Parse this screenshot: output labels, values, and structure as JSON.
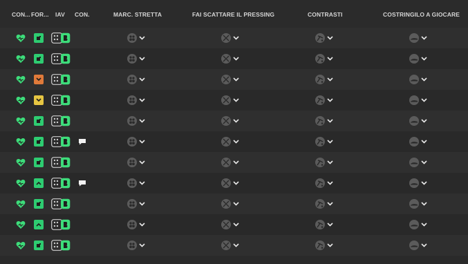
{
  "headers": {
    "condition": "CON...",
    "form": "FOR...",
    "iav": "IAV",
    "conversation": "CON.",
    "close_marking": "MARC. STRETTA",
    "trigger_press": "FAI SCATTARE IL PRESSING",
    "tackling": "CONTRASTI",
    "force_weak_foot": "COSTRINGILO A GIOCARE"
  },
  "colors": {
    "heart": "#3ddc7a",
    "form_good": "#2ecc71",
    "form_warn_orange": "#e07a3a",
    "form_warn_yellow": "#e6c542",
    "iav_green": "#3ddc7a",
    "dropdown_icon": "#5b5b5b"
  },
  "rows": [
    {
      "form": "good",
      "form_icon": "square-dot",
      "conversation": false
    },
    {
      "form": "good",
      "form_icon": "square-dot",
      "conversation": false
    },
    {
      "form": "orange",
      "form_icon": "chevron-down",
      "conversation": false
    },
    {
      "form": "yellow",
      "form_icon": "chevron-down",
      "conversation": false
    },
    {
      "form": "good",
      "form_icon": "square-dot",
      "conversation": false
    },
    {
      "form": "good",
      "form_icon": "square-dot",
      "conversation": true
    },
    {
      "form": "good",
      "form_icon": "square-dot",
      "conversation": false
    },
    {
      "form": "good",
      "form_icon": "chevron-up",
      "conversation": true
    },
    {
      "form": "good",
      "form_icon": "square-dot",
      "conversation": false
    },
    {
      "form": "good",
      "form_icon": "chevron-up",
      "conversation": false
    },
    {
      "form": "good",
      "form_icon": "square-dot",
      "conversation": false
    }
  ]
}
